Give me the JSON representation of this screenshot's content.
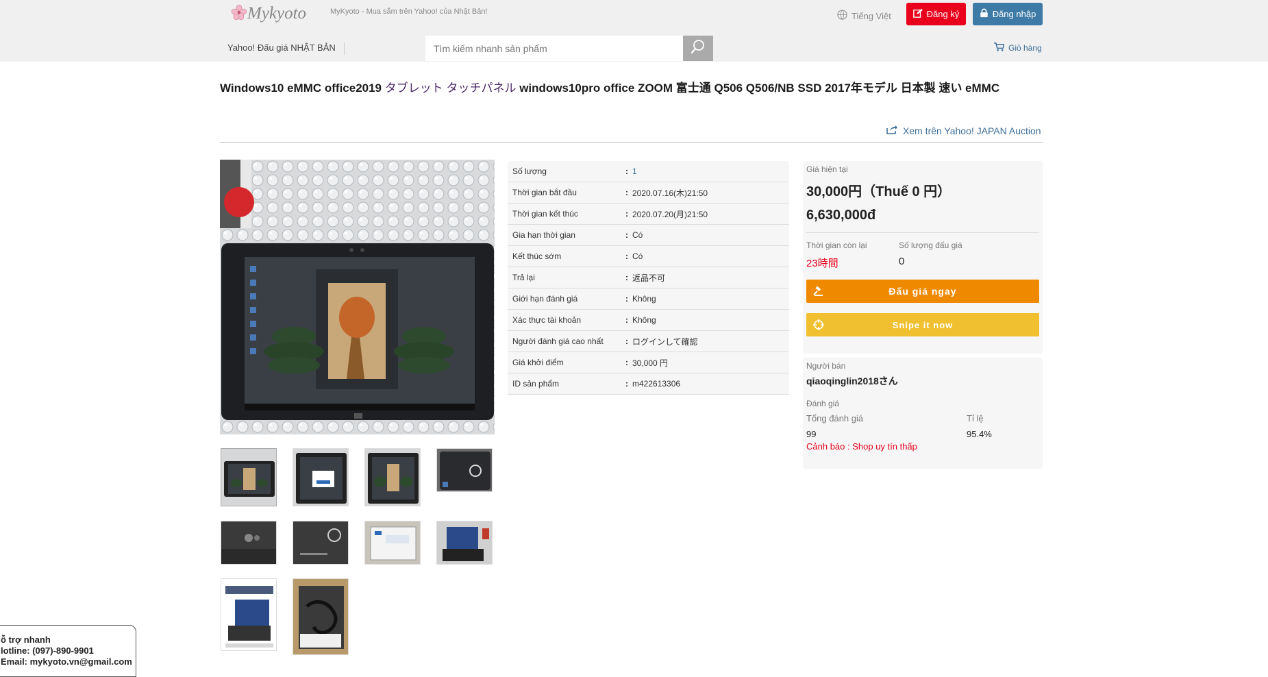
{
  "header": {
    "logo_text": "Mykyoto",
    "tagline": "MyKyoto - Mua sắm trên Yahoo! của Nhật Bản!",
    "language": "Tiếng Việt",
    "register_label": "Đăng ký",
    "login_label": "Đăng nhập"
  },
  "nav": {
    "yahoo_label": "Yahoo! Đấu giá NHẬT BẢN",
    "search_placeholder": "Tìm kiếm nhanh sản phẩm",
    "cart_label": "Giỏ hàng"
  },
  "product": {
    "title_a": "Windows10 eMMC office2019 ",
    "title_jp": "タブレット タッチパネル ",
    "title_b": "windows10pro office ZOOM 富士通 Q506 Q506/NB SSD 2017年モデル 日本製 速い eMMC",
    "yahoo_link": "Xem trên Yahoo! JAPAN Auction"
  },
  "specs": [
    {
      "label": "Số lượng",
      "value": "1"
    },
    {
      "label": "Thời gian bắt đầu",
      "value": "2020.07.16(木)21:50"
    },
    {
      "label": "Thời gian kết thúc",
      "value": "2020.07.20(月)21:50"
    },
    {
      "label": "Gia hạn thời gian",
      "value": "Có"
    },
    {
      "label": "Kết thúc sớm",
      "value": "Có"
    },
    {
      "label": "Trả lại",
      "value": "返品不可"
    },
    {
      "label": "Giới hạn đánh giá",
      "value": "Không"
    },
    {
      "label": "Xác thực tài khoản",
      "value": "Không"
    },
    {
      "label": "Người đánh giá cao nhất",
      "value": "ログインして確認"
    },
    {
      "label": "Giá khởi điểm",
      "value": "30,000 円"
    },
    {
      "label": "ID sản phẩm",
      "value": "m422613306"
    }
  ],
  "price": {
    "current_label": "Giá hiện tại",
    "jpy": "30,000円（Thuế 0 円）",
    "vnd": "6,630,000đ",
    "time_left_label": "Thời gian còn lại",
    "time_left": "23時間",
    "bid_count_label": "Số lượng đấu giá",
    "bid_count": "0",
    "bid_button": "Đấu giá ngay",
    "snipe_button": "Snipe it now"
  },
  "seller": {
    "label": "Người bán",
    "name": "qiaoqinglin2018さん",
    "rating_label": "Đánh giá",
    "total_label": "Tổng đánh giá",
    "total_value": "99",
    "ratio_label": "Tỉ lệ",
    "ratio_value": "95.4%",
    "warning": "Cảnh báo : Shop uy tín thấp"
  },
  "support": {
    "line1": "ỗ trợ nhanh",
    "line2": "lotline: (097)-890-9901",
    "line3": "Email: mykyoto.vn@gmail.com"
  },
  "colors": {
    "register": "#e8001c",
    "login": "#3d7aa6",
    "bid": "#ef8a00",
    "snipe": "#f0c030",
    "link": "#3d6e99"
  }
}
